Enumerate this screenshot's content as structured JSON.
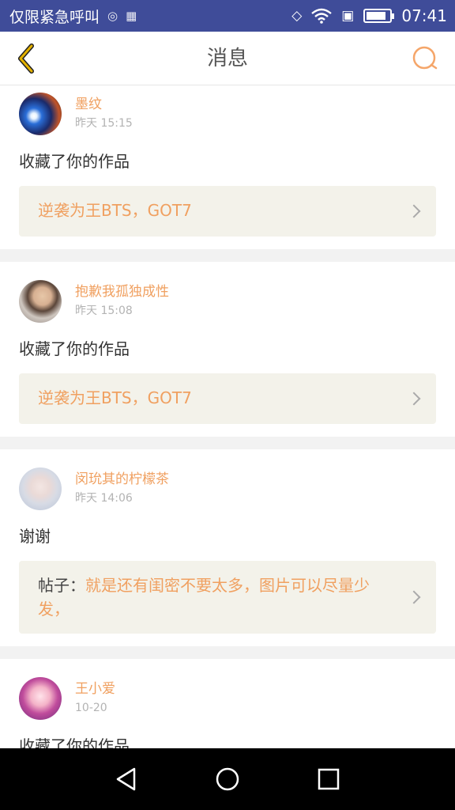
{
  "status_bar": {
    "carrier": "仅限紧急呼叫",
    "time": "07:41",
    "battery_level": 0.85
  },
  "header": {
    "title": "消息"
  },
  "messages": [
    {
      "user": "墨纹",
      "time": "昨天 15:15",
      "text": "收藏了你的作品",
      "ref_label": "",
      "ref_text": "逆袭为王BTS，GOT7"
    },
    {
      "user": "抱歉我孤独成性",
      "time": "昨天 15:08",
      "text": "收藏了你的作品",
      "ref_label": "",
      "ref_text": "逆袭为王BTS，GOT7"
    },
    {
      "user": "闵玧其的柠檬茶",
      "time": "昨天 14:06",
      "text": "谢谢",
      "ref_label": "帖子：",
      "ref_text": "就是还有闺密不要太多，图片可以尽量少发，"
    },
    {
      "user": "王小爱",
      "time": "10-20",
      "text": "收藏了你的作品",
      "ref_label": "",
      "ref_text": ""
    }
  ],
  "colors": {
    "status_bar": "#3f4c99",
    "accent": "#f0a060",
    "back_icon": "#e3b100",
    "search_icon": "#f5a66a",
    "ref_background": "#f3f2ea"
  },
  "icons": {
    "back": "chevron-left-icon",
    "search": "search-icon",
    "nav_back": "triangle-back-icon",
    "nav_home": "circle-home-icon",
    "nav_recents": "square-recents-icon"
  }
}
